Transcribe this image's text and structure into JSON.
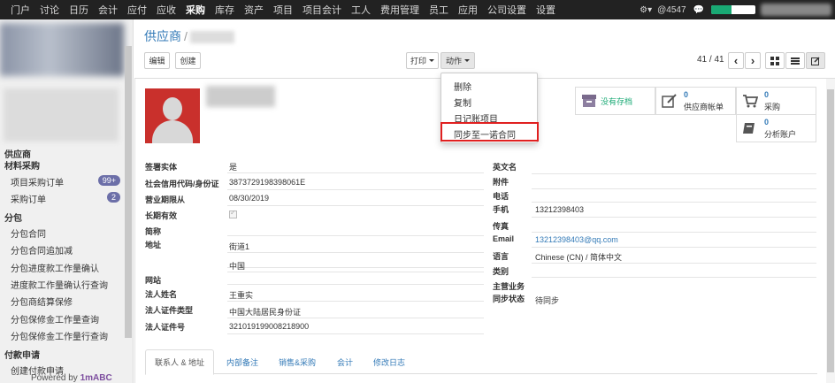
{
  "topbar": {
    "menu": [
      "门户",
      "讨论",
      "日历",
      "会计",
      "应付",
      "应收",
      "采购",
      "库存",
      "资产",
      "项目",
      "项目会计",
      "工人",
      "费用管理",
      "员工",
      "应用",
      "公司设置",
      "设置"
    ],
    "active": "采购",
    "gear_icon": "gear-icon",
    "mentions": "@4547",
    "chat_icon": "chat-icon",
    "progress": 0.45
  },
  "sidebar": {
    "sections": [
      {
        "label": "供应商",
        "type": "head"
      },
      {
        "label": "材料采购",
        "type": "head"
      },
      {
        "label": "项目采购订单",
        "type": "item",
        "badge": "99+"
      },
      {
        "label": "采购订单",
        "type": "item",
        "badge": "2"
      },
      {
        "label": "分包",
        "type": "head"
      },
      {
        "label": "分包合同",
        "type": "item"
      },
      {
        "label": "分包合同追加减",
        "type": "item"
      },
      {
        "label": "分包进度款工作量确认",
        "type": "item"
      },
      {
        "label": "进度款工作量确认行查询",
        "type": "item"
      },
      {
        "label": "分包商结算保修",
        "type": "item"
      },
      {
        "label": "分包保修金工作量查询",
        "type": "item"
      },
      {
        "label": "分包保修金工作量行查询",
        "type": "item"
      },
      {
        "label": "付款申请",
        "type": "head"
      },
      {
        "label": "创建付款申请",
        "type": "item"
      }
    ],
    "powered_prefix": "Powered by ",
    "powered_brand": "1mABC"
  },
  "breadcrumb": {
    "root": "供应商",
    "sep": "/"
  },
  "toolbar": {
    "edit": "编辑",
    "create": "创建",
    "print": "打印",
    "action": "动作",
    "pager": "41 / 41",
    "prev_icon": "‹",
    "next_icon": "›"
  },
  "action_menu": [
    "删除",
    "复制",
    "日记账项目",
    "同步至一诺合同"
  ],
  "stats": {
    "stock": "没有存档",
    "vendor_bills_count": "0",
    "vendor_bills": "供应商帐单",
    "purchase_count": "0",
    "purchase": "采购",
    "analytic_count": "0",
    "analytic": "分析账户"
  },
  "left_fields": [
    {
      "label": "签署实体",
      "value": "是"
    },
    {
      "label": "社会信用代码/身份证",
      "value": "3873729198398061E"
    },
    {
      "label": "营业期限从",
      "value": "08/30/2019"
    },
    {
      "label": "长期有效",
      "value": ""
    },
    {
      "label": "简称",
      "value": ""
    },
    {
      "label": "地址",
      "value": "街道1"
    },
    {
      "label": "",
      "value": "中国"
    },
    {
      "label": "网站",
      "value": ""
    },
    {
      "label": "法人姓名",
      "value": "王重实"
    },
    {
      "label": "法人证件类型",
      "value": "中国大陆居民身份证"
    },
    {
      "label": "法人证件号",
      "value": "321019199008218900"
    }
  ],
  "right_fields": [
    {
      "label": "英文名",
      "value": ""
    },
    {
      "label": "附件",
      "value": ""
    },
    {
      "label": "电话",
      "value": ""
    },
    {
      "label": "手机",
      "value": "13212398403"
    },
    {
      "label": "传真",
      "value": ""
    },
    {
      "label": "Email",
      "value": "13212398403@qq.com"
    },
    {
      "label": "语言",
      "value": "Chinese (CN) / 简体中文"
    },
    {
      "label": "类别",
      "value": ""
    },
    {
      "label": "主营业务",
      "value": ""
    },
    {
      "label": "同步状态",
      "value": "待同步"
    }
  ],
  "tabs": [
    "联系人 & 地址",
    "内部备注",
    "销售&采购",
    "会计",
    "修改日志"
  ]
}
